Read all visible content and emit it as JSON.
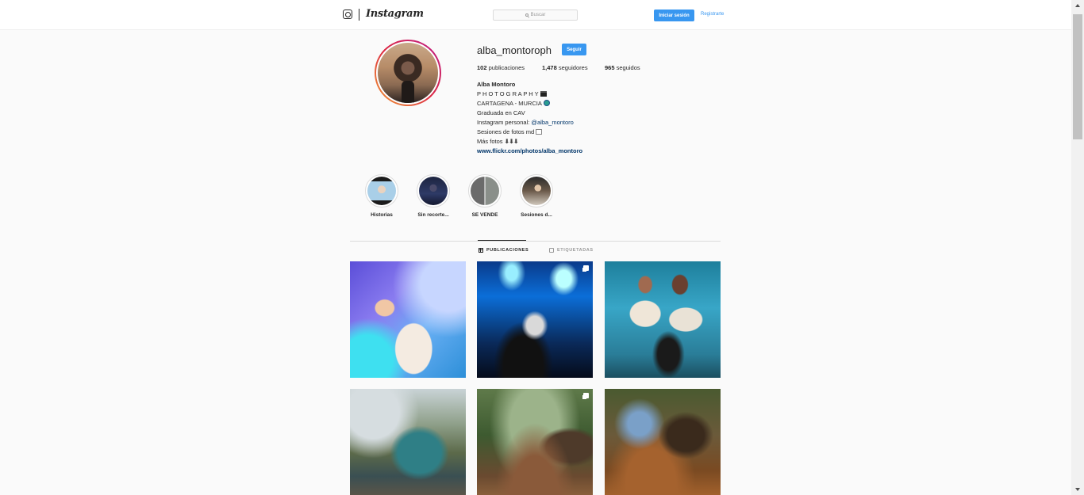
{
  "nav": {
    "wordmark": "Instagram",
    "search_placeholder": "Buscar",
    "login_label": "Iniciar sesión",
    "register_label": "Registrarte"
  },
  "profile": {
    "username": "alba_montoroph",
    "follow_label": "Seguir",
    "stats": [
      {
        "count": "102",
        "label": "publicaciones"
      },
      {
        "count": "1,478",
        "label": "seguidores"
      },
      {
        "count": "965",
        "label": "seguidos"
      }
    ],
    "bio": {
      "name": "Alba Montoro",
      "line1": "P H O T O G R A P H Y",
      "line2": "CARTAGENA - MURCIA",
      "line3": "Graduada en CAV",
      "line4_prefix": "Instagram personal: ",
      "line4_mention": "@alba_montoro",
      "line5": "Sesiones de fotos md",
      "line6": "Más fotos",
      "line6_arrows": "⬇⬇⬇",
      "link": "www.flickr.com/photos/alba_montoro"
    }
  },
  "highlights": [
    {
      "label": "Historias",
      "icon": "story-highlight"
    },
    {
      "label": "Sin recorte...",
      "icon": "story-highlight"
    },
    {
      "label": "SE VENDE",
      "icon": "story-highlight"
    },
    {
      "label": "Sesiones d...",
      "icon": "story-highlight"
    }
  ],
  "tabs": {
    "posts_label": "PUBLICACIONES",
    "tagged_label": "ETIQUETADAS",
    "active": "posts"
  },
  "posts": [
    {
      "multi": false
    },
    {
      "multi": true
    },
    {
      "multi": false
    },
    {
      "multi": false
    },
    {
      "multi": true
    },
    {
      "multi": false
    }
  ],
  "colors": {
    "accent": "#3897f0",
    "link": "#003569",
    "text": "#262626",
    "muted": "#999999",
    "background": "#fafafa"
  }
}
